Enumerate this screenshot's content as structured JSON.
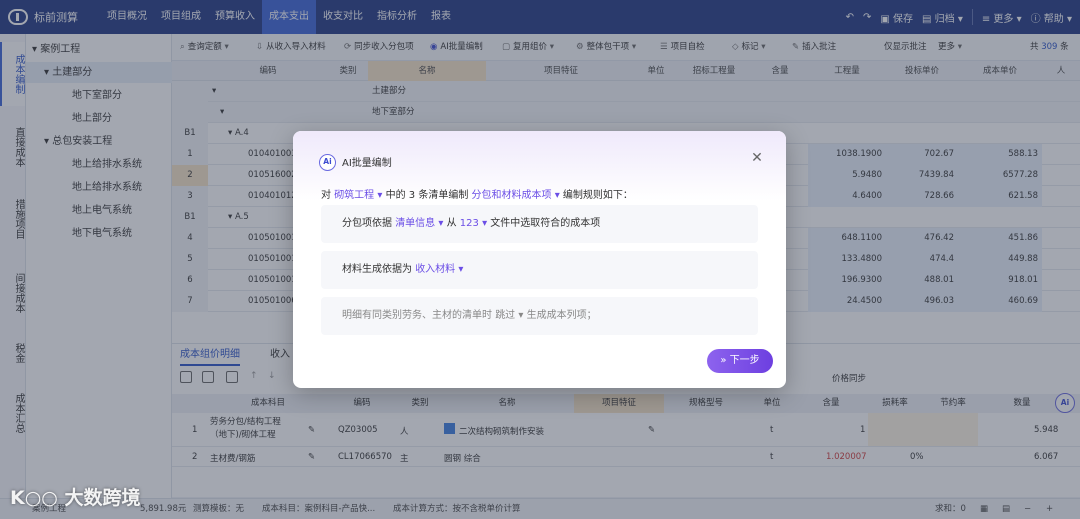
{
  "app": {
    "name": "标前测算"
  },
  "topnav": [
    "项目概况",
    "项目组成",
    "预算收入",
    "成本支出",
    "收支对比",
    "指标分析",
    "报表"
  ],
  "topright": {
    "save": "保存",
    "archive": "归档",
    "more": "更多",
    "help": "帮助"
  },
  "left_rail": [
    "成本编制",
    "直接成本",
    "措施项目",
    "间接成本",
    "税金",
    "成本汇总"
  ],
  "tree": [
    "案例工程",
    "土建部分",
    "地下室部分",
    "地上部分",
    "总包安装工程",
    "地上给排水系统",
    "地上给排水系统",
    "地上电气系统",
    "地下电气系统"
  ],
  "toolbar": {
    "items": [
      "查询定额",
      "从收入导入材料",
      "同步收入分包项",
      "AI批量编制",
      "复用组价",
      "整体包干项",
      "项目自检",
      "标记",
      "插入批注",
      "仅显示批注",
      "更多"
    ],
    "count_prefix": "共",
    "count": "309",
    "count_suffix": "条"
  },
  "grid": {
    "headers": [
      "编码",
      "类别",
      "名称",
      "项目特征",
      "单位",
      "招标工程量",
      "含量",
      "工程量",
      "投标单价",
      "成本单价",
      "人"
    ],
    "groups": [
      "土建部分",
      "地下室部分"
    ],
    "sections": [
      {
        "num": "B1",
        "code": "A.4"
      },
      {
        "num": "B1",
        "code": "A.5"
      }
    ],
    "rows": [
      {
        "num": "1",
        "code": "010401003",
        "qty": "1038.1900",
        "bid": "702.67",
        "cost": "588.13"
      },
      {
        "num": "2",
        "code": "010516002",
        "qty": "5.9480",
        "bid": "7439.84",
        "cost": "6577.28"
      },
      {
        "num": "3",
        "code": "010401012",
        "qty": "4.6400",
        "bid": "728.66",
        "cost": "621.58"
      },
      {
        "num": "4",
        "code": "010501001",
        "qty": "648.1100",
        "bid": "476.42",
        "cost": "451.86"
      },
      {
        "num": "5",
        "code": "010501001",
        "qty": "133.4800",
        "bid": "474.4",
        "cost": "449.88"
      },
      {
        "num": "6",
        "code": "010501001",
        "qty": "196.9300",
        "bid": "488.01",
        "cost": "918.01"
      },
      {
        "num": "7",
        "code": "010501006",
        "qty": "24.4500",
        "bid": "496.03",
        "cost": "460.69"
      }
    ]
  },
  "bottom": {
    "tabs": [
      "成本组价明细",
      "收入"
    ],
    "price_sync": "价格同步",
    "headers": [
      "成本科目",
      "编码",
      "类别",
      "名称",
      "项目特征",
      "规格型号",
      "单位",
      "含量",
      "损耗率",
      "节约率",
      "数量"
    ],
    "rows": [
      {
        "num": "1",
        "subject": "劳务分包/结构工程（地下)/砌体工程",
        "code": "QZ03005",
        "type": "人",
        "name": "二次结构砌筑制作安装",
        "unit": "t",
        "content": "1",
        "loss": "",
        "qty": "5.948"
      },
      {
        "num": "2",
        "subject": "主材费/钢筋",
        "code": "CL17066570",
        "type": "主",
        "name": "圆钢 综合",
        "unit": "t",
        "content": "1.020007",
        "loss": "0%",
        "qty": "6.067"
      }
    ]
  },
  "status": {
    "items": [
      "案例工程",
      "5,891.98元",
      "测算模板：无",
      "成本科目：案例科目-产品快...",
      "成本计算方式：按不含税单价计算"
    ],
    "sum_label": "求和：0"
  },
  "dialog": {
    "badge": "Ai",
    "title": "AI批量编制",
    "line": {
      "p1": "对",
      "project": "砌筑工程",
      "p2": "中的 3 条清单编制",
      "target": "分包和材料成本项",
      "p3": "编制规则如下："
    },
    "rule1": {
      "p1": "分包项依据",
      "sel1": "清单信息",
      "p2": "从",
      "sel2": "123",
      "p3": "文件中选取符合的成本项"
    },
    "rule2": {
      "p1": "材料生成依据为",
      "sel1": "收入材料"
    },
    "rule3": {
      "p1": "明细有同类别劳务、主材的清单时",
      "sel1": "跳过",
      "p2": "生成成本列项；"
    },
    "next": "下一步"
  },
  "watermark": "大数跨境",
  "colors": {
    "nav": "#233a84",
    "active": "#3c64d8",
    "accent": "#6b4ee6"
  }
}
